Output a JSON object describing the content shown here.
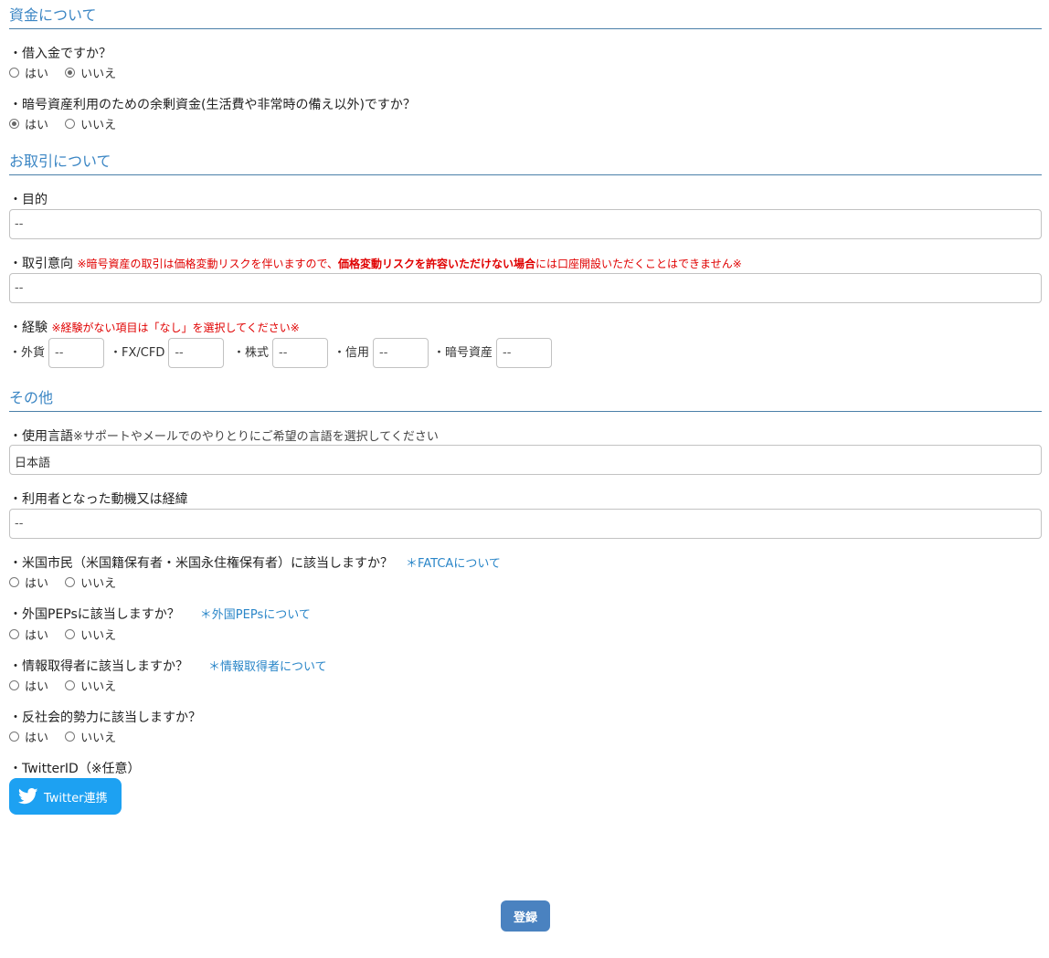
{
  "sections": {
    "funds": "資金について",
    "trading": "お取引について",
    "other": "その他"
  },
  "questions": {
    "borrowed": "・借入金ですか？",
    "surplus": "・暗号資産利用のための余剰資金(生活費や非常時の備え以外)ですか？",
    "purpose": "・目的",
    "intent": "・取引意向 ",
    "intent_note_pre": "※暗号資産の取引は価格変動リスクを伴いますので、",
    "intent_note_bold": "価格変動リスクを許容いただけない場合",
    "intent_note_post": "には口座開設いただくことはできません※",
    "experience": "・経験 ",
    "experience_note": "※経験がない項目は「なし」を選択してください※",
    "language": "・使用言語",
    "language_note": "※サポートやメールでのやりとりにご希望の言語を選択してください",
    "motive": "・利用者となった動機又は経緯",
    "us_citizen": "・米国市民（米国籍保有者・米国永住権保有者）に該当しますか？",
    "us_citizen_link": "＊FATCAについて",
    "peps": "・外国PEPsに該当しますか？",
    "peps_link": "＊外国PEPsについて",
    "info_acquirer": "・情報取得者に該当しますか？",
    "info_acquirer_link": "＊情報取得者について",
    "antisocial": "・反社会的勢力に該当しますか？",
    "twitter_id": "・TwitterID（※任意）"
  },
  "radio_labels": {
    "yes": "はい",
    "no": "いいえ"
  },
  "inputs": {
    "purpose": "--",
    "intent": "--",
    "language": "日本語",
    "motive": "--"
  },
  "experience_items": [
    {
      "label": "・外貨",
      "value": "--"
    },
    {
      "label": "・FX/CFD",
      "value": "--"
    },
    {
      "label": "・株式",
      "value": "--"
    },
    {
      "label": "・信用",
      "value": "--"
    },
    {
      "label": "・暗号資産",
      "value": "--"
    }
  ],
  "buttons": {
    "twitter": "Twitter連携",
    "submit": "登録"
  },
  "colors": {
    "accent": "#3b86c4",
    "twitter": "#1da1f2",
    "submit": "#4a82c0",
    "warning": "#e00000"
  }
}
